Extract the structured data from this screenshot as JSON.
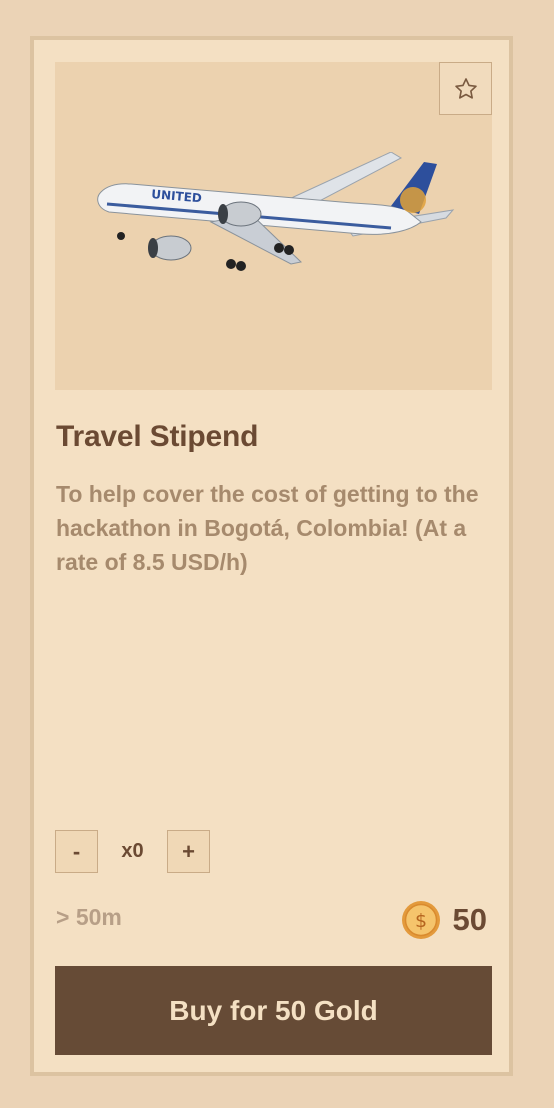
{
  "item": {
    "title": "Travel Stipend",
    "description": "To help cover the cost of getting to the hackathon in Bogotá, Colombia! (At a rate of 8.5 USD/h)",
    "image_brand_text": "UNITED",
    "favorite_icon": "star-outline-icon"
  },
  "quantity": {
    "decrement_label": "-",
    "value_label": "x0",
    "increment_label": "+"
  },
  "delivery": {
    "eta_label": "> 50m"
  },
  "price": {
    "coin_icon": "gold-coin-icon",
    "amount": "50"
  },
  "buy_button": {
    "label": "Buy for 50 Gold"
  },
  "colors": {
    "page_bg": "#ebd3b6",
    "card_bg": "#f4e0c3",
    "accent_dark": "#664b36",
    "muted_text": "#a68a6d"
  }
}
